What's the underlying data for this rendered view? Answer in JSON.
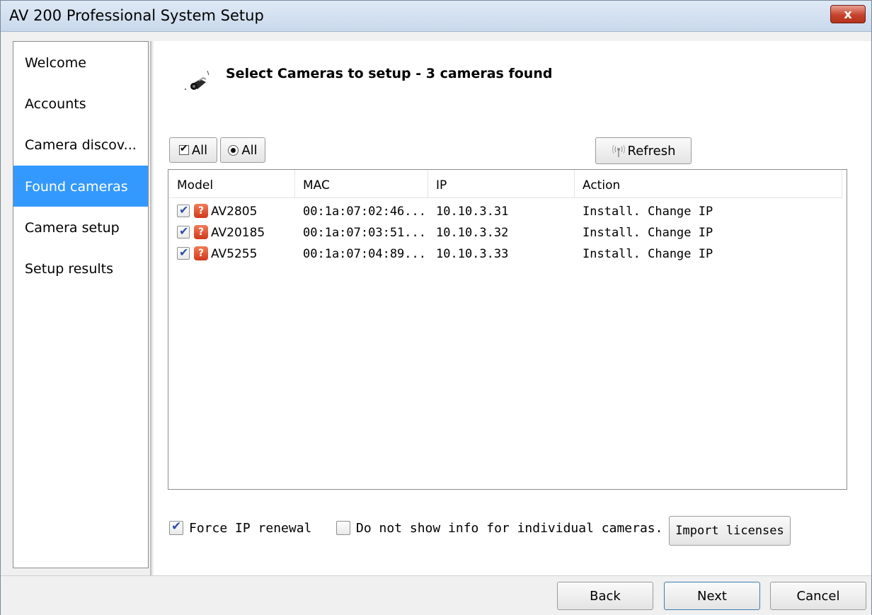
{
  "window": {
    "title": "AV 200 Professional System Setup",
    "close_label": "x"
  },
  "sidebar": {
    "items": [
      {
        "label": "Welcome"
      },
      {
        "label": "Accounts"
      },
      {
        "label": "Camera discov..."
      },
      {
        "label": "Found cameras",
        "active": true
      },
      {
        "label": "Camera setup"
      },
      {
        "label": "Setup results"
      }
    ]
  },
  "header": {
    "title": "Select Cameras to setup - 3 cameras found",
    "icon": "camera-icon"
  },
  "toolbar": {
    "check_all_label": "All",
    "radio_all_label": "All",
    "refresh_label": "Refresh",
    "refresh_icon": "antenna-icon"
  },
  "table": {
    "columns": [
      "Model",
      "MAC",
      "IP",
      "Action"
    ],
    "rows": [
      {
        "checked": true,
        "status_icon": "question-icon",
        "status_glyph": "?",
        "model": "AV2805",
        "mac": "00:1a:07:02:46...",
        "ip": "10.10.3.31",
        "action": "Install. Change IP"
      },
      {
        "checked": true,
        "status_icon": "question-icon",
        "status_glyph": "?",
        "model": "AV20185",
        "mac": "00:1a:07:03:51...",
        "ip": "10.10.3.32",
        "action": "Install. Change IP"
      },
      {
        "checked": true,
        "status_icon": "question-icon",
        "status_glyph": "?",
        "model": "AV5255",
        "mac": "00:1a:07:04:89...",
        "ip": "10.10.3.33",
        "action": "Install. Change IP"
      }
    ]
  },
  "options": {
    "force_ip_label": "Force IP renewal",
    "force_ip_checked": true,
    "no_info_label": "Do not show info for individual cameras.",
    "no_info_checked": false,
    "import_label": "Import licenses"
  },
  "footer": {
    "back_label": "Back",
    "next_label": "Next",
    "cancel_label": "Cancel"
  },
  "colors": {
    "accent": "#3399ff",
    "close_red": "#c7432c",
    "status_red": "#d0391b"
  }
}
